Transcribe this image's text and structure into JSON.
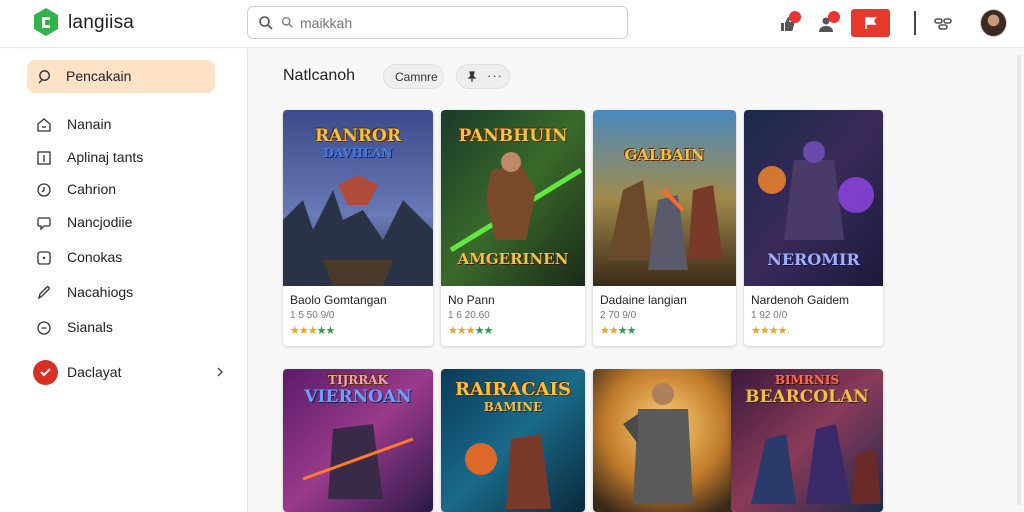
{
  "header": {
    "app_title": "langiisa",
    "search_placeholder": "maikkah"
  },
  "sidebar": {
    "active_label": "Pencakain",
    "items": [
      {
        "label": "Nanain",
        "icon": "home-icon"
      },
      {
        "label": "Aplinaj tants",
        "icon": "apps-icon"
      },
      {
        "label": "Cahrion",
        "icon": "clock-icon"
      },
      {
        "label": "Nancjodiie",
        "icon": "chat-icon"
      },
      {
        "label": "Conokas",
        "icon": "square-icon"
      },
      {
        "label": "Nacahiogs",
        "icon": "pen-icon"
      },
      {
        "label": "Sianals",
        "icon": "minus-circle-icon"
      }
    ],
    "footer_label": "Daclayat"
  },
  "main": {
    "title": "Natlcanoh",
    "chip_label": "Camnre",
    "chip2_more": "···"
  },
  "cards": [
    {
      "art_title": "RANROR",
      "art_sub": "DAVHEAN",
      "name": "Baolo Gomtangan",
      "meta": "1 5 50 9/0",
      "rating": "4/5"
    },
    {
      "art_title": "PANBHUIN",
      "art_sub": "AMGERINEN",
      "name": "No Pann",
      "meta": "1 6 20.60",
      "rating": "4/5"
    },
    {
      "art_title": "GALBAIN",
      "art_sub": "",
      "name": "Dadaine langian",
      "meta": "2 70 9/0",
      "rating": "4/5"
    },
    {
      "art_title": "",
      "art_sub": "NEROMIR",
      "name": "Nardenoh Gaidem",
      "meta": "1 92 0/0",
      "rating": "3.5/5"
    },
    {
      "art_title": "TIJRRAK",
      "art_sub": "VIERNOAN"
    },
    {
      "art_title": "RAIRACAIS",
      "art_sub": "BAMINE"
    },
    {
      "art_title": "",
      "art_sub": ""
    },
    {
      "art_title": "BIMRNIS",
      "art_sub": "BEARCOLAN"
    }
  ],
  "colors": {
    "accent": "#fde2c8",
    "brand_green": "#2fb34a",
    "red": "#e8382b"
  }
}
